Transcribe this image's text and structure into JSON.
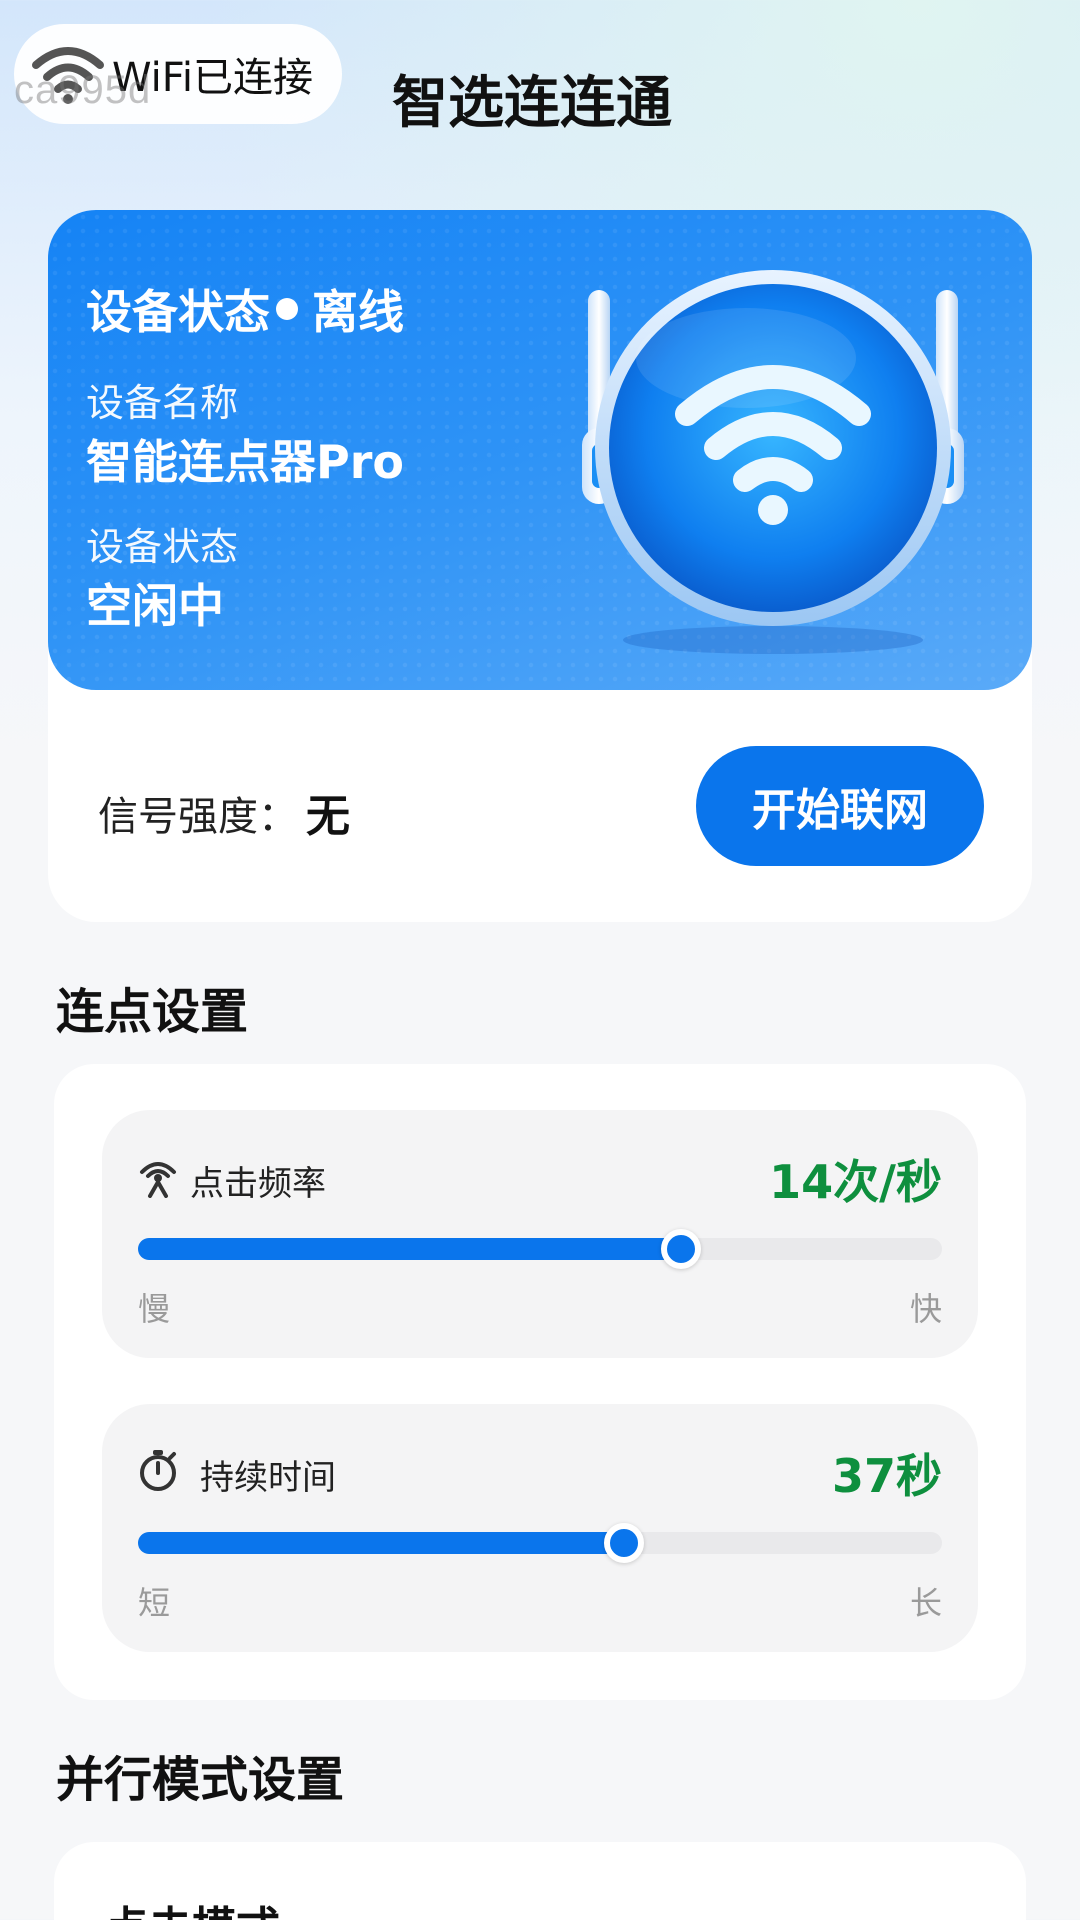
{
  "header": {
    "wifi_status": "WiFi已连接",
    "watermark": "ca995d",
    "title": "智选连连通"
  },
  "device": {
    "status_heading": "设备状态",
    "status_value": "离线",
    "name_label": "设备名称",
    "name_value": "智能连点器Pro",
    "state_label": "设备状态",
    "state_value": "空闲中",
    "signal_label": "信号强度：",
    "signal_value": "无",
    "connect_button": "开始联网"
  },
  "settings": {
    "section_title": "连点设置",
    "frequency": {
      "label": "点击频率",
      "value_text": "14次/秒",
      "fraction": 0.675,
      "min_label": "慢",
      "max_label": "快",
      "icon": "tap-signal-icon"
    },
    "duration": {
      "label": "持续时间",
      "value_text": "37秒",
      "fraction": 0.605,
      "min_label": "短",
      "max_label": "长",
      "icon": "stopwatch-icon"
    }
  },
  "parallel": {
    "section_title": "并行模式设置",
    "card_label": "点击模式"
  },
  "colors": {
    "accent": "#0a75ec",
    "value_green": "#0e8f3e",
    "banner_blue": "#1583f5"
  }
}
